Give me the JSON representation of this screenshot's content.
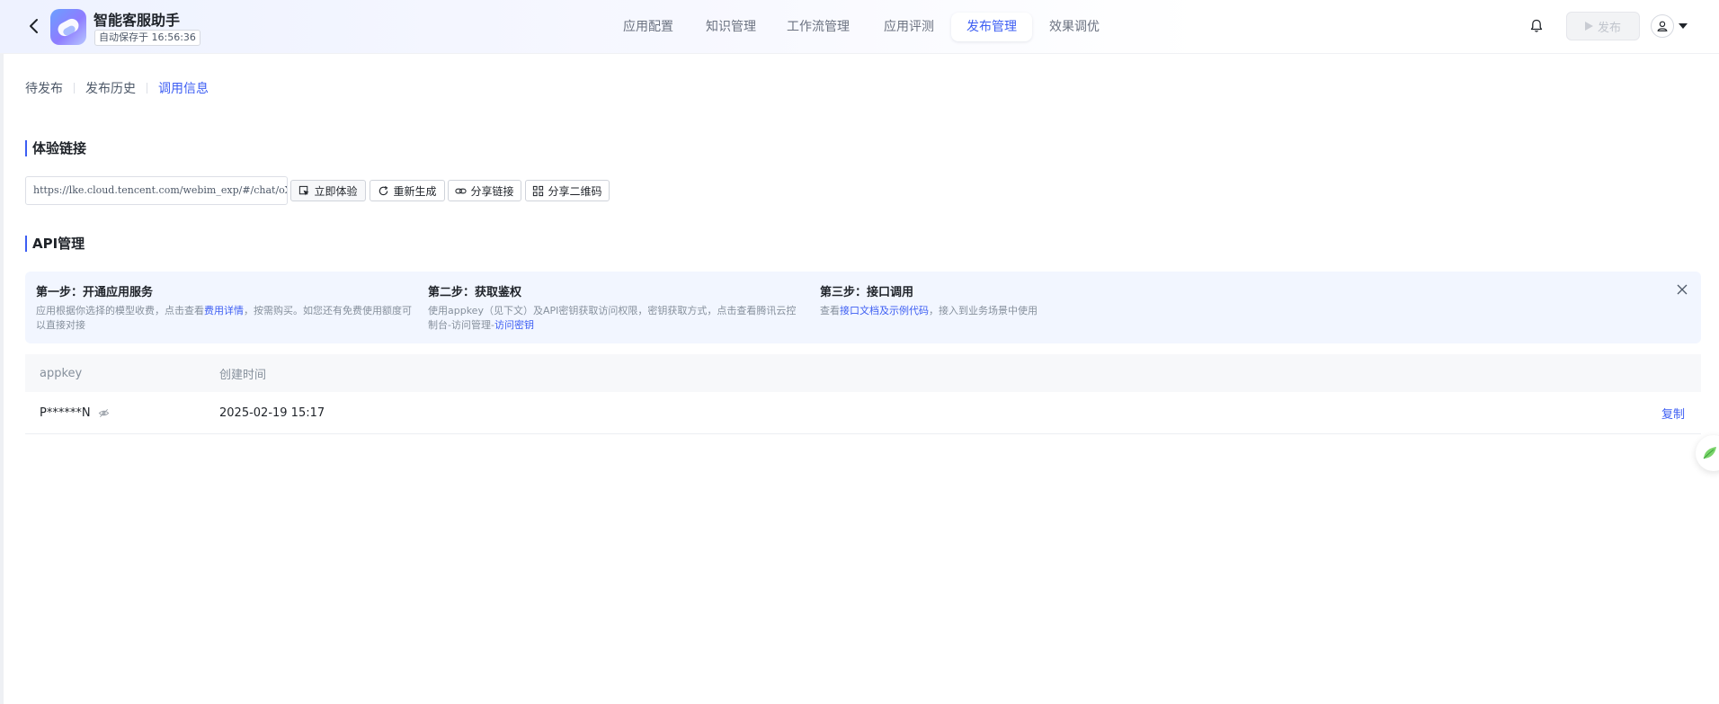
{
  "header": {
    "app_name": "智能客服助手",
    "autosave": "自动保存于 16:56:36",
    "nav": [
      {
        "label": "应用配置",
        "active": false
      },
      {
        "label": "知识管理",
        "active": false
      },
      {
        "label": "工作流管理",
        "active": false
      },
      {
        "label": "应用评测",
        "active": false
      },
      {
        "label": "发布管理",
        "active": true
      },
      {
        "label": "效果调优",
        "active": false
      }
    ],
    "publish_label": "发布"
  },
  "subtabs": [
    {
      "label": "待发布",
      "active": false
    },
    {
      "label": "发布历史",
      "active": false
    },
    {
      "label": "调用信息",
      "active": true
    }
  ],
  "experience": {
    "title": "体验链接",
    "url": "https://lke.cloud.tencent.com/webim_exp/#/chat/oXuETc",
    "buttons": {
      "try_now": "立即体验",
      "regenerate": "重新生成",
      "share_link": "分享链接",
      "share_qr": "分享二维码"
    }
  },
  "api": {
    "title": "API管理",
    "steps": [
      {
        "title": "第一步：开通应用服务",
        "desc_before": "应用根据你选择的模型收费，点击查看",
        "link": "费用详情",
        "desc_after": "，按需购买。如您还有免费使用额度可以直接对接"
      },
      {
        "title": "第二步：获取鉴权",
        "desc_before": "使用appkey（见下文）及API密钥获取访问权限，密钥获取方式，点击查看腾讯云控制台-访问管理-",
        "link": "访问密钥",
        "desc_after": ""
      },
      {
        "title": "第三步：接口调用",
        "desc_before": "查看",
        "link": "接口文档及示例代码",
        "desc_after": "，接入到业务场景中使用"
      }
    ],
    "table": {
      "columns": [
        "appkey",
        "创建时间"
      ],
      "rows": [
        {
          "appkey": "P******N",
          "created": "2025-02-19 15:17",
          "action": "复制"
        }
      ]
    }
  },
  "colors": {
    "accent": "#3d5ef3",
    "panel_bg": "#f2f6ff"
  }
}
